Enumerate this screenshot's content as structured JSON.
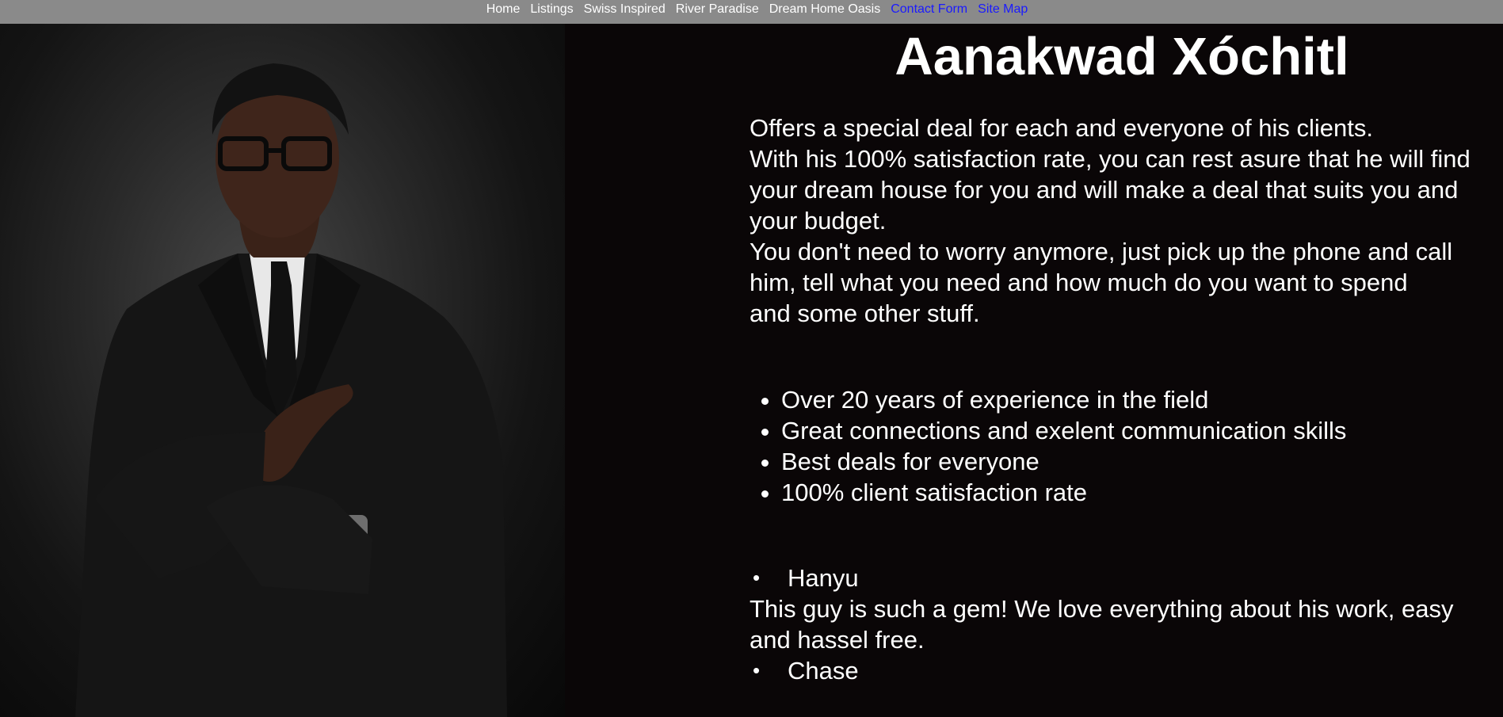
{
  "nav": {
    "links": [
      {
        "label": "Home",
        "color": "#ffffff"
      },
      {
        "label": "Listings",
        "color": "#ffffff"
      },
      {
        "label": "Swiss Inspired",
        "color": "#ffffff"
      },
      {
        "label": "River Paradise",
        "color": "#ffffff"
      },
      {
        "label": "Dream Home Oasis",
        "color": "#ffffff"
      },
      {
        "label": "Contact Form",
        "color": "#1a1aff"
      },
      {
        "label": "Site Map",
        "color": "#1a1aff"
      }
    ],
    "background": "#8a8a8a"
  },
  "agent": {
    "name": "Aanakwad Xóchitl",
    "photo_icon": "agent-portrait"
  },
  "bio": {
    "line1": "Offers a special deal for each and everyone of his clients.",
    "line2": "With his 100% satisfaction rate, you can rest asure that he will find your dream house for you and will make a deal that suits you and your budget.",
    "line3": "You don't need to worry anymore, just pick up the phone and call him, tell what you need and how much do you want to spend",
    "line4": "and some other stuff."
  },
  "features": [
    "Over 20 years of experience in the field",
    "Great connections and exelent communication skills",
    "Best deals for everyone",
    "100% client satisfaction rate"
  ],
  "reviews": [
    {
      "bullet": "•",
      "name": "Hanyu",
      "text": "This guy is such a gem! We love everything about his work, easy and hassel free."
    },
    {
      "bullet": "•",
      "name": "Chase",
      "text": ""
    }
  ],
  "colors": {
    "page_background": "#0a0607",
    "text": "#ffffff"
  }
}
